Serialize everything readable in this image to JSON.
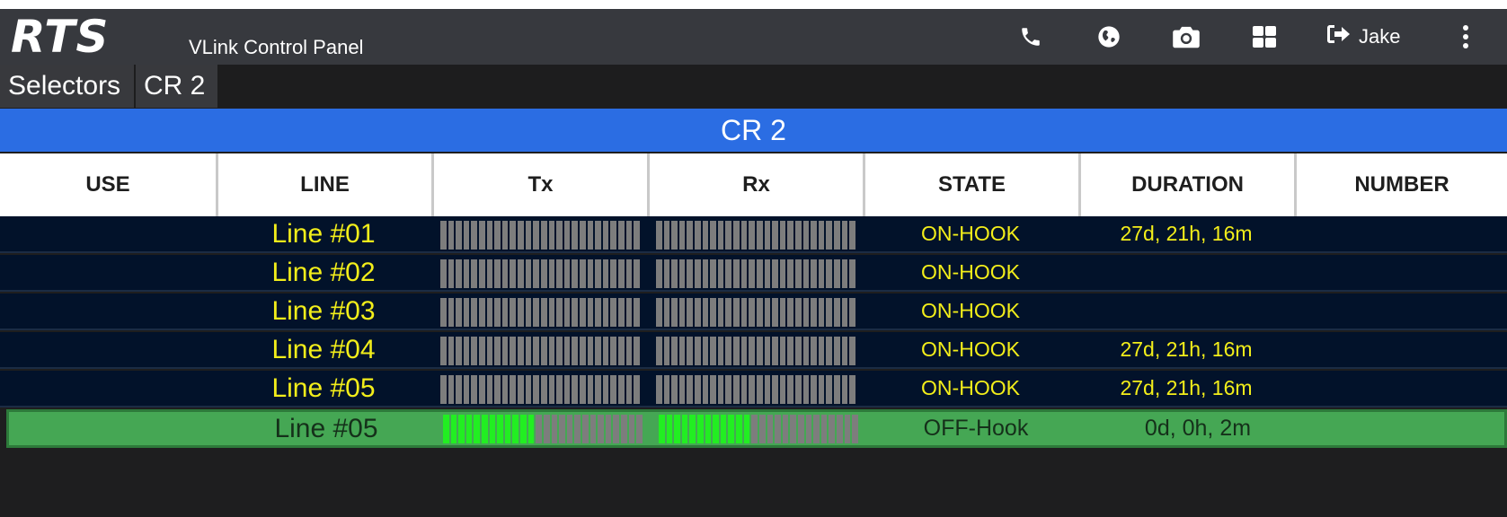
{
  "header": {
    "logo": "RTS",
    "title": "VLink Control Panel",
    "user": "Jake",
    "icons": [
      "phone-icon",
      "globe-icon",
      "camera-icon",
      "grid-icon",
      "logout-icon",
      "more-vertical-icon"
    ]
  },
  "tabs": [
    {
      "label": "Selectors"
    },
    {
      "label": "CR 2"
    }
  ],
  "panel": {
    "title": "CR 2",
    "columns": [
      "USE",
      "LINE",
      "Tx",
      "Rx",
      "STATE",
      "DURATION",
      "NUMBER"
    ],
    "rows": [
      {
        "line": "Line #01",
        "tx_level": 0,
        "rx_level": 0,
        "state": "ON-HOOK",
        "duration": "27d, 21h, 16m",
        "number": ""
      },
      {
        "line": "Line #02",
        "tx_level": 0,
        "rx_level": 0,
        "state": "ON-HOOK",
        "duration": "",
        "number": ""
      },
      {
        "line": "Line #03",
        "tx_level": 0,
        "rx_level": 0,
        "state": "ON-HOOK",
        "duration": "",
        "number": ""
      },
      {
        "line": "Line #04",
        "tx_level": 0,
        "rx_level": 0,
        "state": "ON-HOOK",
        "duration": "27d, 21h, 16m",
        "number": ""
      },
      {
        "line": "Line #05",
        "tx_level": 0,
        "rx_level": 0,
        "state": "ON-HOOK",
        "duration": "27d, 21h, 16m",
        "number": ""
      },
      {
        "line": "Line #05",
        "tx_level": 0.45,
        "rx_level": 0.45,
        "state": "OFF-Hook",
        "duration": "0d, 0h, 2m",
        "number": "",
        "active": true
      }
    ]
  },
  "colors": {
    "header_bg": "#37393e",
    "banner_blue": "#2b6de3",
    "row_bg": "#02122a",
    "text_yellow": "#f3ee1a",
    "active_green": "#45a754",
    "meter_lit": "#22ee22",
    "meter_off": "#7d7d7d"
  }
}
